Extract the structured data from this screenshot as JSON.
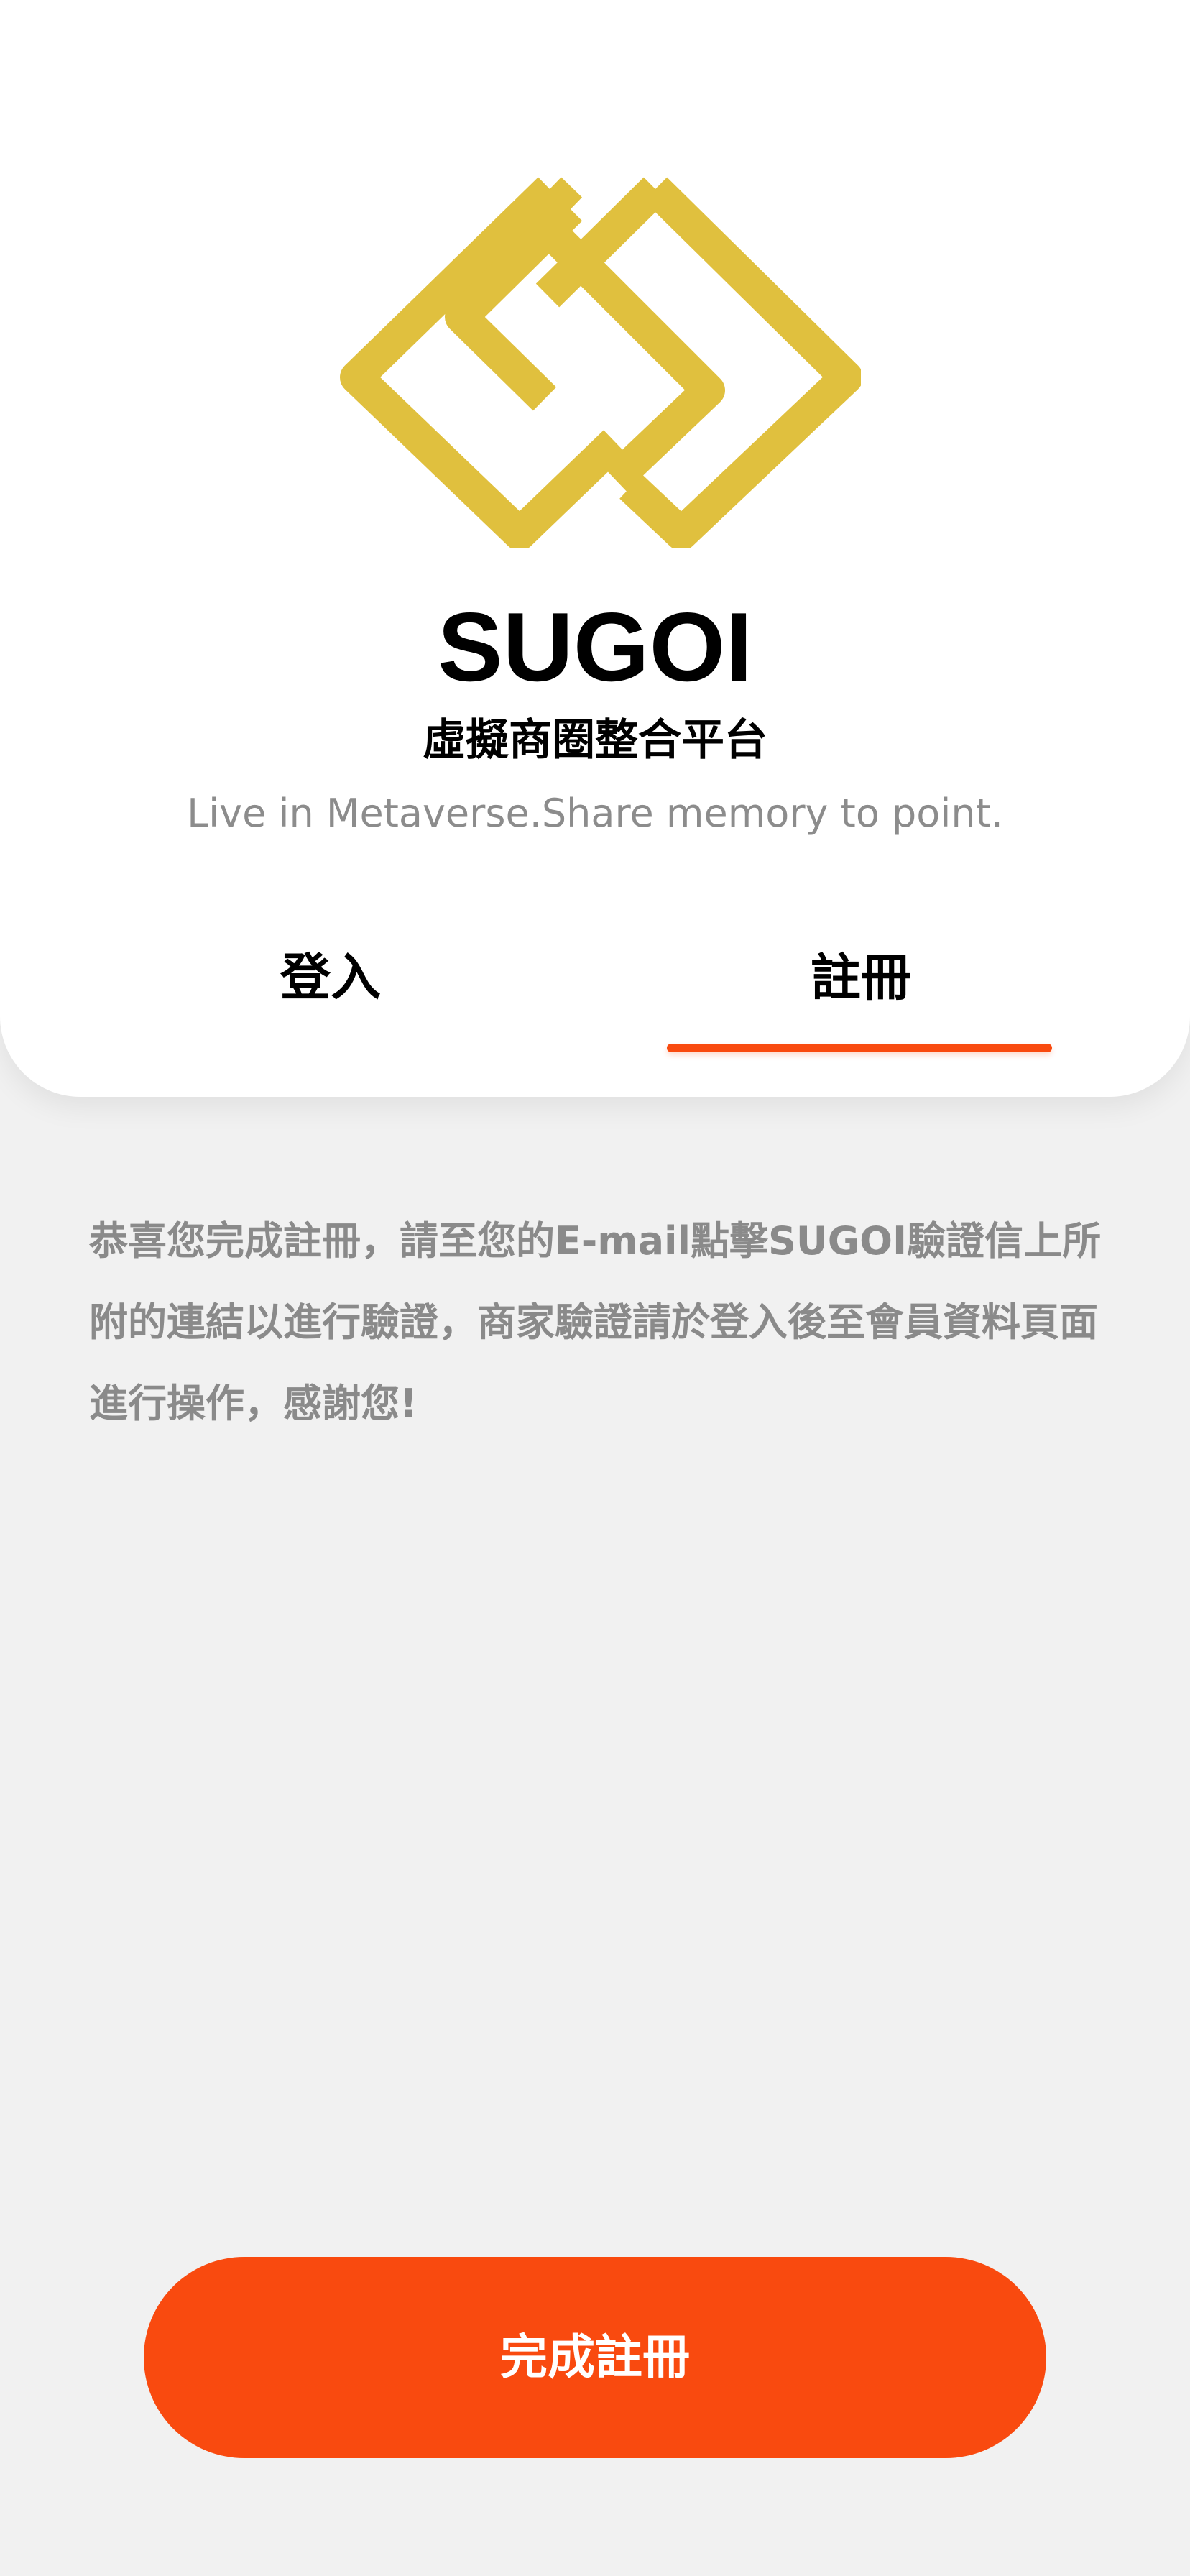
{
  "brand": {
    "name": "SUGOI",
    "subtitle": "虛擬商圈整合平台",
    "slogan": "Live in Metaverse.Share memory to point.",
    "logo_icon": "sugoi-logo-icon",
    "logo_color": "#E0C03E"
  },
  "tabs": [
    {
      "label": "登入",
      "active": false
    },
    {
      "label": "註冊",
      "active": true
    }
  ],
  "message": {
    "text": "恭喜您完成註冊，請至您的E-mail點擊SUGOI驗證信上所附的連結以進行驗證，商家驗證請於登入後至會員資料頁面進行操作，感謝您!"
  },
  "actions": {
    "complete_label": "完成註冊"
  },
  "colors": {
    "accent": "#F94A0F",
    "background": "#F1F1F1",
    "card": "#FFFFFF",
    "muted_text": "#8A8A8A"
  }
}
